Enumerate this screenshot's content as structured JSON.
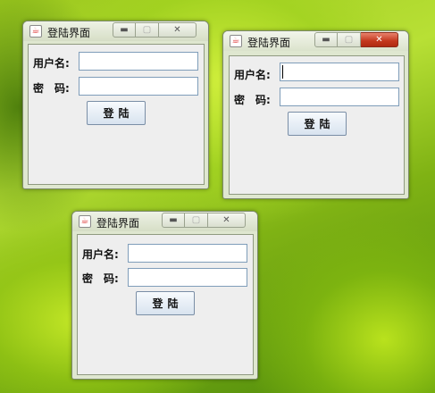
{
  "windows": [
    {
      "title": "登陆界面",
      "username_label": "用户名:",
      "password_label": "密　码:",
      "username_value": "",
      "password_value": "",
      "login_label": "登陆",
      "state": "inactive"
    },
    {
      "title": "登陆界面",
      "username_label": "用户名:",
      "password_label": "密　码:",
      "username_value": "",
      "password_value": "",
      "login_label": "登陆",
      "state": "active"
    },
    {
      "title": "登陆界面",
      "username_label": "用户名:",
      "password_label": "密　码:",
      "username_value": "",
      "password_value": "",
      "login_label": "登陆",
      "state": "inactive"
    }
  ],
  "controls": {
    "minimize": "▬",
    "maximize": "▢",
    "close": "✕"
  },
  "icon": {
    "app": "java-icon",
    "glyph": "☕"
  },
  "colors": {
    "close_active": "#c3371d",
    "field_border": "#7f9db9",
    "button_border": "#7a8ea6"
  }
}
